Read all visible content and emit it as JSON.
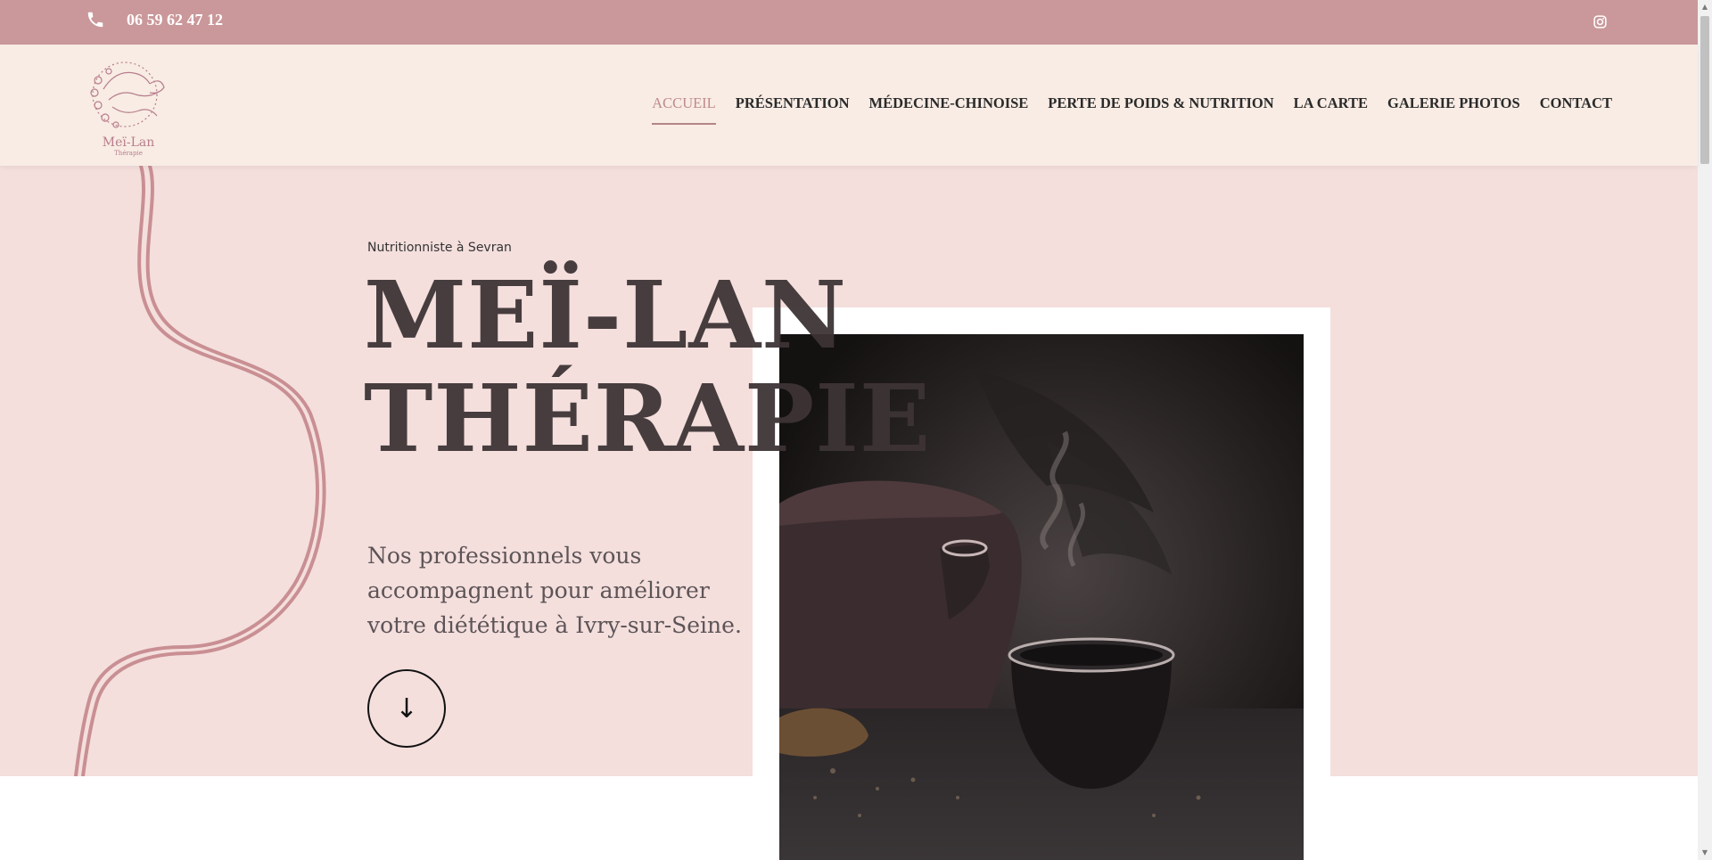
{
  "topbar": {
    "phone": "06 59 62 47 12",
    "phone_icon": "phone-icon",
    "social_icon": "instagram-icon"
  },
  "header": {
    "logo": {
      "name": "Meï-Lan",
      "tagline": "Thérapie"
    },
    "nav": [
      {
        "label": "ACCUEIL",
        "active": true
      },
      {
        "label": "PRÉSENTATION"
      },
      {
        "label": "MÉDECINE-CHINOISE"
      },
      {
        "label": "PERTE DE POIDS & NUTRITION"
      },
      {
        "label": "LA CARTE"
      },
      {
        "label": "GALERIE PHOTOS"
      },
      {
        "label": "CONTACT"
      }
    ]
  },
  "hero": {
    "subtitle": "Nutritionniste à Sevran",
    "title_line1": "MEÏ-LAN",
    "title_line2": "THÉRAPIE",
    "lead": "Nos professionnels vous accompagnent pour améliorer votre diététique à Ivry-sur-Seine.",
    "scroll_icon": "arrow-down-icon",
    "scroll_glyph": "↓",
    "image": "tea-cup-photo"
  },
  "colors": {
    "topbar_bg": "#ca989a",
    "nav_bg": "#f8ece4",
    "hero_bg": "#f4dfdd",
    "accent": "#c08a8a",
    "title": "#3d3436"
  }
}
